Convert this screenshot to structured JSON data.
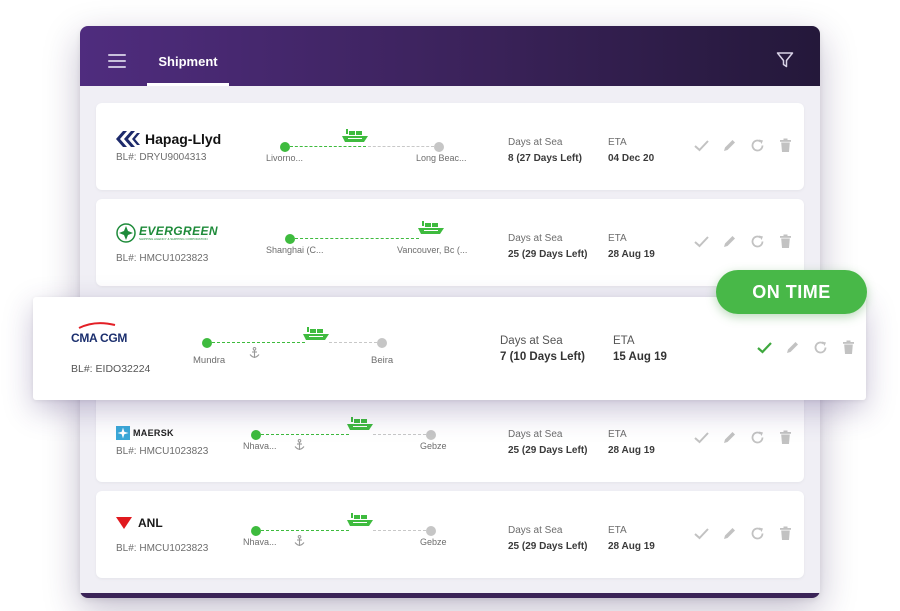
{
  "header": {
    "tab_label": "Shipment"
  },
  "labels": {
    "days_at_sea": "Days at Sea",
    "eta": "ETA"
  },
  "badge": {
    "text": "ON TIME",
    "color": "#48b848"
  },
  "colors": {
    "route_done": "#3ebb3e",
    "route_pending": "#c8c8c8",
    "header_start": "#4f2c7e",
    "header_end": "#24183a"
  },
  "shipments": [
    {
      "carrier": "Hapag-Llyd",
      "bl": "BL#: DRYU9004313",
      "origin": "Livorno...",
      "destination": "Long Beac...",
      "days": "8 (27 Days Left)",
      "eta": "04 Dec 20"
    },
    {
      "carrier": "EVERGREEN",
      "carrier_sub": "SHIPPING AGENCY & SHIPPING CORPORATION",
      "bl": "BL#: HMCU1023823",
      "origin": "Shanghai (C...",
      "destination": "Vancouver, Bc (...",
      "days": "25 (29 Days Left)",
      "eta": "28 Aug 19"
    },
    {
      "carrier": "CMA CGM",
      "bl": "BL#: EIDO32224",
      "origin": "Mundra",
      "destination": "Beira",
      "days": "7 (10 Days Left)",
      "eta": "15 Aug 19"
    },
    {
      "carrier": "MAERSK",
      "bl": "BL#: HMCU1023823",
      "origin": "Nhava...",
      "destination": "Gebze",
      "days": "25 (29 Days Left)",
      "eta": "28 Aug 19"
    },
    {
      "carrier": "ANL",
      "bl": "BL#: HMCU1023823",
      "origin": "Nhava...",
      "destination": "Gebze",
      "days": "25 (29 Days Left)",
      "eta": "28 Aug 19"
    }
  ],
  "icons": [
    "menu-icon",
    "filter-icon",
    "ship-icon",
    "anchor-icon",
    "check-icon",
    "edit-icon",
    "refresh-icon",
    "delete-icon"
  ]
}
